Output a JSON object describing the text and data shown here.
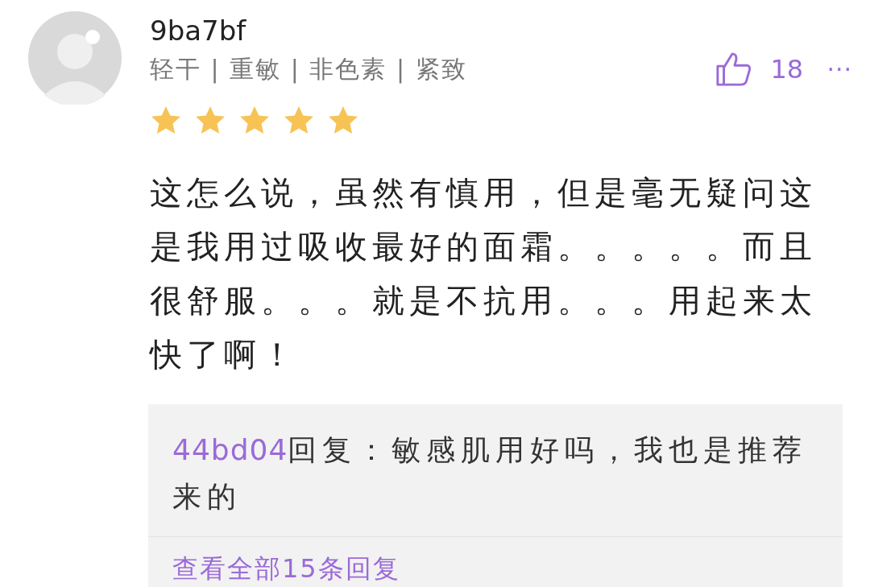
{
  "comment": {
    "author": "9ba7bf",
    "tags": "轻干 | 重敏 | 非色素 | 紧致",
    "likes": "18",
    "more": "···",
    "stars": 5,
    "text": "这怎么说，虽然有慎用，但是毫无疑问这是我用过吸收最好的面霜。。。。。而且很舒服。。。就是不抗用。。。用起来太快了啊！",
    "reply": {
      "author": "44bd04",
      "text": "回复：敏感肌用好吗，我也是推荐来的"
    },
    "view_all": "查看全部15条回复"
  }
}
